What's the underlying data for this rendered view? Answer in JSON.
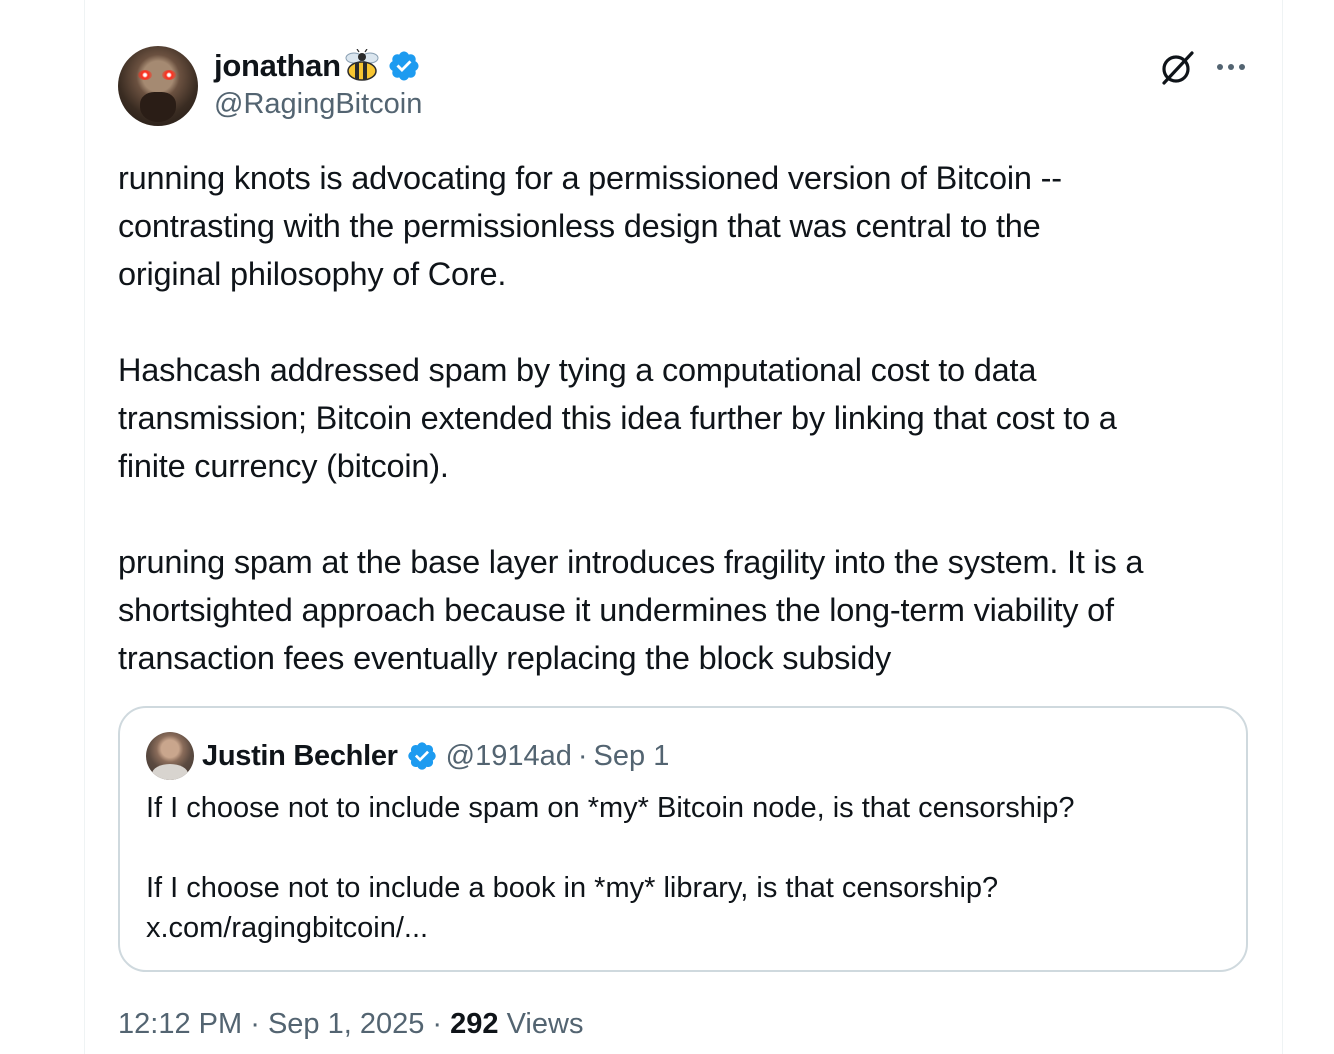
{
  "author": {
    "display_name": "jonathan",
    "emoji": "bee",
    "handle": "@RagingBitcoin",
    "verified": true
  },
  "icons": {
    "bee": "bee-icon",
    "verified": "verified-badge-icon",
    "grok": "grok-icon",
    "more": "more-options-icon"
  },
  "tweet": {
    "text": "running knots is advocating for a permissioned version of Bitcoin --\ncontrasting with the permissionless design that was central to the\noriginal philosophy of Core.\n\nHashcash addressed spam by tying a computational cost to data\ntransmission; Bitcoin extended this idea further by linking that cost to a\nfinite currency (bitcoin).\n\npruning spam at the base layer introduces fragility into the system. It is a\nshortsighted approach because it undermines the long-term viability of\ntransaction fees eventually replacing the block subsidy"
  },
  "quote": {
    "display_name": "Justin Bechler",
    "handle": "@1914ad",
    "separator": "·",
    "date": "Sep 1",
    "text": "If I choose not to include spam on *my* Bitcoin node, is that censorship?\n\nIf I choose not to include a book in *my* library, is that censorship?\nx.com/ragingbitcoin/..."
  },
  "footer": {
    "time": "12:12 PM",
    "separator": "·",
    "date": "Sep 1, 2025",
    "views_count": "292",
    "views_label": "Views"
  },
  "colors": {
    "text": "#0f1419",
    "secondary": "#536471",
    "verified": "#1d9bf0",
    "border": "#cfd9de"
  }
}
